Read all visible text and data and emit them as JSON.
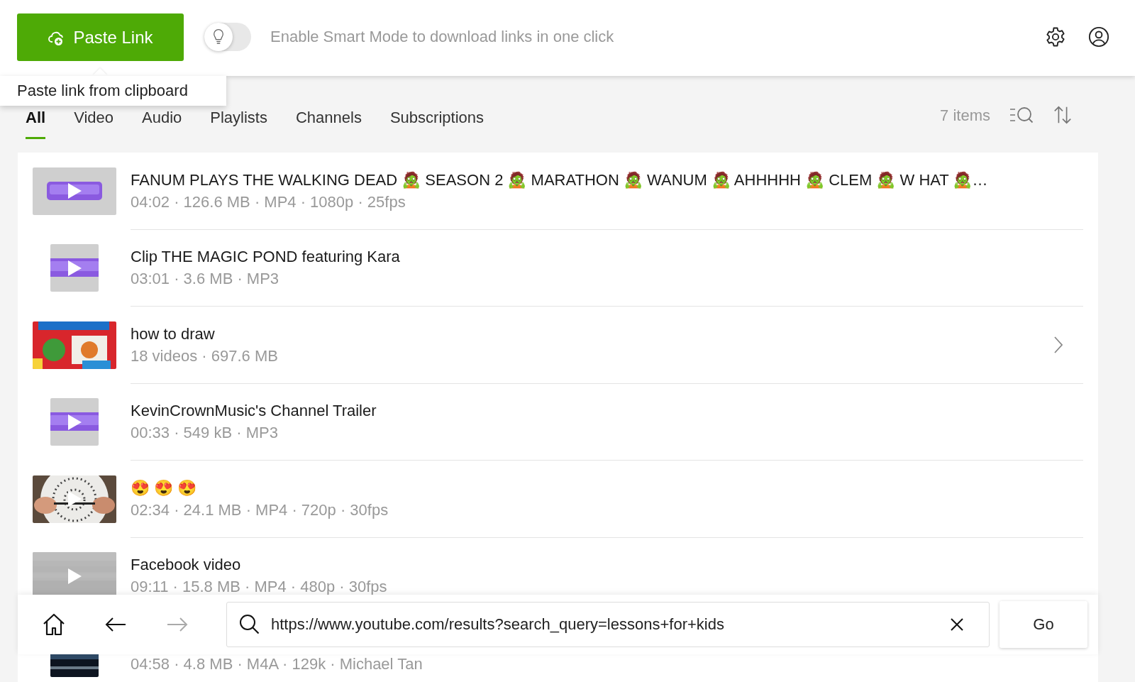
{
  "header": {
    "paste_button": "Paste Link",
    "smart_mode": {
      "on": false,
      "label": "Enable Smart Mode to download links in one click"
    }
  },
  "tooltip": "Paste link from clipboard",
  "tabs": [
    {
      "label": "All",
      "selected": true
    },
    {
      "label": "Video",
      "selected": false
    },
    {
      "label": "Audio",
      "selected": false
    },
    {
      "label": "Playlists",
      "selected": false
    },
    {
      "label": "Channels",
      "selected": false
    },
    {
      "label": "Subscriptions",
      "selected": false
    }
  ],
  "item_count": "7 items",
  "items": [
    {
      "kind": "video",
      "title": "FANUM PLAYS THE WALKING DEAD 🧟 SEASON 2 🧟 MARATHON 🧟 WANUM 🧟 AHHHHH 🧟 CLEM 🧟 W HAT 🧟…",
      "meta": "04:02 · 126.6 MB · MP4 · 1080p · 25fps",
      "thumbnail": {
        "kind": "placeholder",
        "play": true
      },
      "chevron": false
    },
    {
      "kind": "audio",
      "title": "Clip THE MAGIC POND featuring Kara",
      "meta": "03:01 · 3.6 MB · MP3",
      "thumbnail": {
        "kind": "placeholder",
        "play": true
      },
      "chevron": false
    },
    {
      "kind": "playlist",
      "title": "how to draw",
      "meta": "18 videos · 697.6 MB",
      "thumbnail": {
        "kind": "picture",
        "play": false
      },
      "chevron": true
    },
    {
      "kind": "audio",
      "title": "KevinCrownMusic's Channel Trailer",
      "meta": "00:33 · 549 kB · MP3",
      "thumbnail": {
        "kind": "placeholder",
        "play": true
      },
      "chevron": false
    },
    {
      "kind": "video",
      "title": "😍 😍 😍",
      "meta": "02:34 · 24.1 MB · MP4 · 720p · 30fps",
      "thumbnail": {
        "kind": "picture",
        "play": true
      },
      "chevron": false
    },
    {
      "kind": "video",
      "title": "Facebook video",
      "meta": "09:11 · 15.8 MB · MP4 · 480p · 30fps",
      "thumbnail": {
        "kind": "blank",
        "play": true
      },
      "chevron": false
    },
    {
      "kind": "audio",
      "meta": "04:58 · 4.8 MB · M4A · 129k · Michael Tan",
      "thumbnail": {
        "kind": "picture",
        "play": false
      },
      "chevron": false
    }
  ],
  "browser_bar": {
    "back_disabled": false,
    "forward_disabled": true,
    "url": "https://www.youtube.com/results?search_query=lessons+for+kids",
    "go_button": "Go"
  }
}
